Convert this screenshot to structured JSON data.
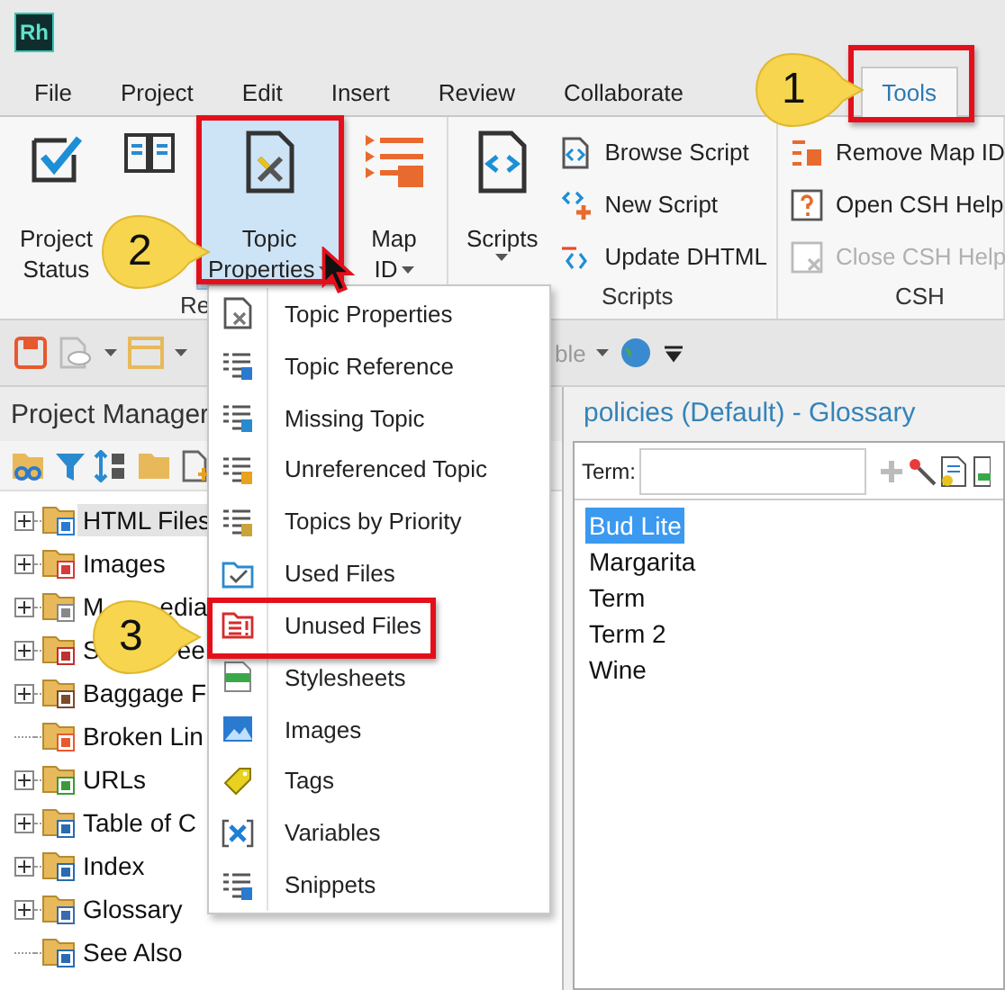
{
  "app_logo": "Rh",
  "menu_tabs": [
    {
      "label": "File",
      "selected": false
    },
    {
      "label": "Project",
      "selected": false
    },
    {
      "label": "Edit",
      "selected": false
    },
    {
      "label": "Insert",
      "selected": false
    },
    {
      "label": "Review",
      "selected": false
    },
    {
      "label": "Collaborate",
      "selected": false
    },
    {
      "label": "Tools",
      "selected": true
    }
  ],
  "ribbon": {
    "groups": [
      {
        "label": "Re",
        "large": [
          {
            "kind": "status",
            "lines": [
              "Project",
              "Status"
            ],
            "dropdown": false,
            "selected": false
          },
          {
            "kind": "book",
            "dropdown": false,
            "selected": false
          },
          {
            "kind": "properties",
            "lines": [
              "Topic",
              "Properties"
            ],
            "dropdown": true,
            "selected": true
          },
          {
            "kind": "mapid",
            "lines": [
              "Map",
              "ID"
            ],
            "dropdown": true,
            "selected": false
          }
        ]
      },
      {
        "label": "Scripts",
        "large": [
          {
            "kind": "script",
            "lines": [
              "Scripts"
            ],
            "dropdown": true,
            "selected": false
          }
        ],
        "small": [
          {
            "kind": "browse",
            "label": "Browse Script",
            "disabled": false
          },
          {
            "kind": "new",
            "label": "New Script",
            "disabled": false
          },
          {
            "kind": "update",
            "label": "Update DHTML",
            "disabled": false
          }
        ]
      },
      {
        "label": "CSH",
        "small": [
          {
            "kind": "remove",
            "label": "Remove Map ID",
            "disabled": false
          },
          {
            "kind": "help",
            "label": "Open CSH Help",
            "disabled": false
          },
          {
            "kind": "close",
            "label": "Close CSH Help",
            "disabled": true
          }
        ]
      }
    ]
  },
  "quick_toolbar": {
    "cut_label": "ble"
  },
  "project_manager": {
    "title": "Project Manager",
    "tree": [
      {
        "kind": "html",
        "label": "HTML Files",
        "expandable": true,
        "selected": true
      },
      {
        "kind": "images",
        "label": "Images",
        "expandable": true,
        "selected": false
      },
      {
        "kind": "media",
        "label": "M",
        "label_tail": "edia",
        "expandable": true,
        "selected": false
      },
      {
        "kind": "style",
        "label": "S",
        "label_tail": "ee",
        "expandable": true,
        "selected": false
      },
      {
        "kind": "baggage",
        "label": "Baggage F",
        "expandable": true,
        "selected": false
      },
      {
        "kind": "broken",
        "label": "Broken Lin",
        "expandable": false,
        "selected": false
      },
      {
        "kind": "urls",
        "label": "URLs",
        "expandable": true,
        "selected": false
      },
      {
        "kind": "toc",
        "label": "Table of C",
        "expandable": true,
        "selected": false
      },
      {
        "kind": "index",
        "label": "Index",
        "expandable": true,
        "selected": false
      },
      {
        "kind": "glossary",
        "label": "Glossary",
        "expandable": true,
        "selected": false
      },
      {
        "kind": "seealso",
        "label": "See Also",
        "expandable": false,
        "selected": false
      }
    ]
  },
  "glossary_pane": {
    "title": "policies (Default) - Glossary",
    "term_label": "Term:",
    "terms": [
      {
        "label": "Bud Lite",
        "selected": true
      },
      {
        "label": "Margarita",
        "selected": false
      },
      {
        "label": "Term",
        "selected": false
      },
      {
        "label": "Term 2",
        "selected": false
      },
      {
        "label": "Wine",
        "selected": false
      }
    ]
  },
  "dropdown_menu": [
    {
      "kind": "props",
      "label": "Topic Properties"
    },
    {
      "kind": "ref",
      "label": "Topic Reference"
    },
    {
      "kind": "missing",
      "label": "Missing Topic"
    },
    {
      "kind": "unref",
      "label": "Unreferenced Topic"
    },
    {
      "kind": "priority",
      "label": "Topics by Priority"
    },
    {
      "kind": "used",
      "label": "Used Files"
    },
    {
      "kind": "unused",
      "label": "Unused Files"
    },
    {
      "kind": "css",
      "label": "Stylesheets"
    },
    {
      "kind": "image",
      "label": "Images"
    },
    {
      "kind": "tag",
      "label": "Tags"
    },
    {
      "kind": "var",
      "label": "Variables"
    },
    {
      "kind": "snippet",
      "label": "Snippets"
    }
  ],
  "callouts": [
    {
      "number": "1"
    },
    {
      "number": "2"
    },
    {
      "number": "3"
    }
  ]
}
